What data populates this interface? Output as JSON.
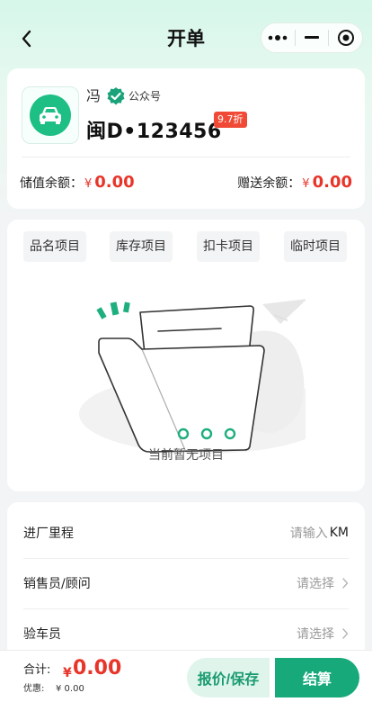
{
  "nav": {
    "title": "开单"
  },
  "customer": {
    "name": "冯",
    "account_tag": "公众号",
    "plate": "闽D•123456",
    "discount": "9.7折",
    "stored_balance_label": "储值余额：",
    "stored_balance_currency": "¥",
    "stored_balance": "0.00",
    "gift_balance_label": "赠送余额：",
    "gift_balance_currency": "¥",
    "gift_balance": "0.00"
  },
  "tabs": [
    {
      "label": "品名项目"
    },
    {
      "label": "库存项目"
    },
    {
      "label": "扣卡项目"
    },
    {
      "label": "临时项目"
    }
  ],
  "empty_text": "当前暂无项目",
  "form": {
    "mileage_label": "进厂里程",
    "mileage_placeholder": "请输入",
    "mileage_unit": "KM",
    "sales_label": "销售员/顾问",
    "sales_placeholder": "请选择",
    "inspector_label": "验车员",
    "inspector_placeholder": "请选择"
  },
  "footer": {
    "total_label": "合计:",
    "total_currency": "¥",
    "total_amount": "0.00",
    "discount_label": "优惠:",
    "discount_amount": "¥ 0.00",
    "save_label": "报价/保存",
    "pay_label": "结算"
  },
  "colors": {
    "brand": "#17a97a",
    "price": "#e8352a",
    "discount_badge": "#f04a36"
  },
  "icons": {
    "back": "chevron-left-icon",
    "more": "more-dots-icon",
    "minimize": "minus-icon",
    "close": "target-circle-icon",
    "car": "car-icon",
    "verified": "verified-badge-icon",
    "chevron": "chevron-right-icon"
  }
}
